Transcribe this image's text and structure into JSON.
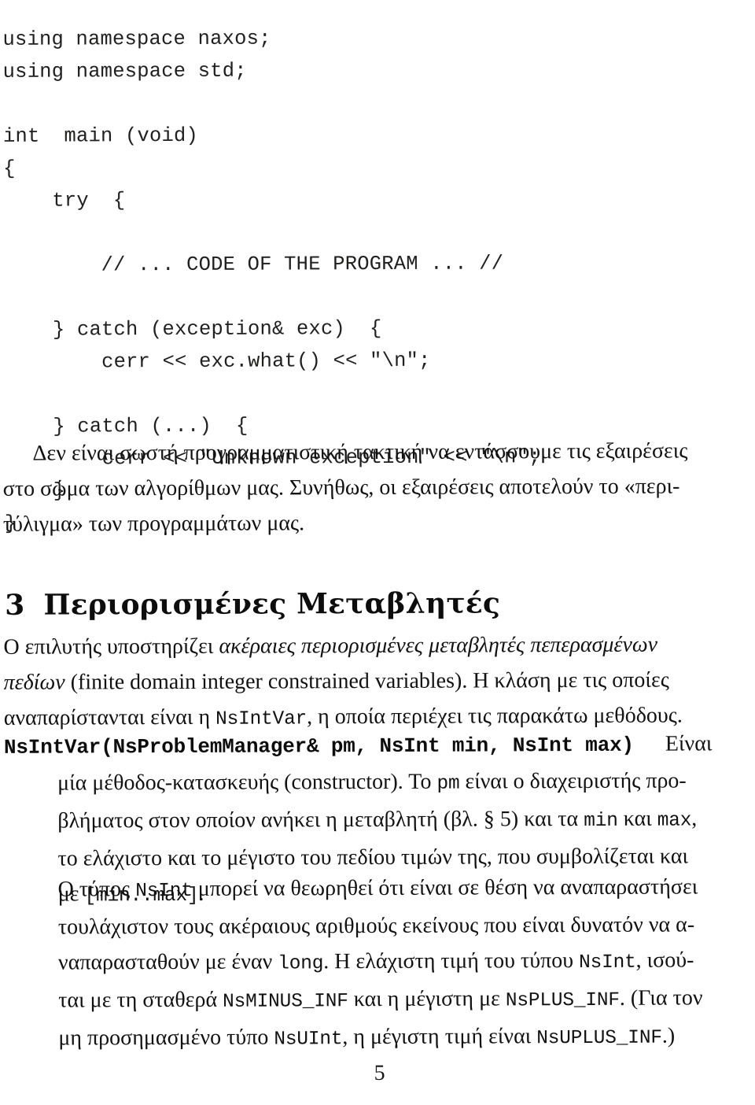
{
  "code_listing": {
    "name": "cpp-exception-skeleton",
    "lines": [
      "using namespace naxos;",
      "using namespace std;",
      "",
      "int  main (void)",
      "{",
      "    try  {",
      "",
      "        // ... CODE OF THE PROGRAM ... //",
      "",
      "    } catch (exception& exc)  {",
      "        cerr << exc.what() << \"\\n\";",
      "",
      "    } catch (...)  {",
      "        cerr << \"Unknown exception\" << \"\\n\";",
      "    }",
      "}"
    ]
  },
  "intro_paragraph": {
    "lines": [
      "Δεν είναι σωστή προγραμματιστική τακτική να εντάσσουμε τις εξαιρέσεις",
      "στο σώμα των αλγορίθμων μας. Συνήθως, οι εξαιρέσεις αποτελούν το «περι-",
      "τύλιγμα» των προγραμμάτων μας."
    ]
  },
  "section": {
    "number": "3",
    "title": "Περιορισμένες Μεταβλητές"
  },
  "solver_paragraph": {
    "line1_prefix": "Ο επιλυτής υποστηρίζει ",
    "line1_italic": "ακέραιες περιορισμένες μεταβλητές πεπερασμένων",
    "line2_italic": "πεδίων",
    "line2_rest": " (finite domain integer constrained variables). Η κλάση με τις οποίες",
    "line3_prefix": "αναπαρίστανται είναι η ",
    "line3_mono": "NsIntVar",
    "line3_suffix": ", η οποία περιέχει τις παρακάτω μεθόδους."
  },
  "constructor_entry": {
    "signature": "NsIntVar(NsProblemManager& pm, NsInt min, NsInt max)",
    "signature_tail": "Είναι",
    "desc_line1_a": "μία μέθοδος-κατασκευής (constructor). Το ",
    "desc_line1_mono": "pm",
    "desc_line1_b": " είναι ο διαχειριστής προ-",
    "desc_line2_a": "βλήματος στον οποίον ανήκει η μεταβλητή (βλ. § 5) και τα ",
    "desc_line2_mono1": "min",
    "desc_line2_b": " και ",
    "desc_line2_mono2": "max",
    "desc_line2_c": ",",
    "desc_line3": "το ελάχιστο και το μέγιστο του πεδίου τιμών της, που συμβολίζεται και",
    "desc_line4_a": "με ",
    "desc_line4_mono": "[min..max]",
    "desc_line4_b": "."
  },
  "nsint_paragraph": {
    "line1_a": "Ο τύπος ",
    "line1_mono": "NsInt",
    "line1_b": " μπορεί να θεωρηθεί ότι είναι σε θέση να αναπαραστήσει",
    "line2": "τουλάχιστον τους ακέραιους αριθμούς εκείνους που είναι δυνατόν να α-",
    "line3_a": "ναπαρασταθούν με έναν ",
    "line3_mono1": "long",
    "line3_b": ". Η ελάχιστη τιμή του τύπου ",
    "line3_mono2": "NsInt",
    "line3_c": ", ισού-",
    "line4_a": "ται με τη σταθερά ",
    "line4_mono1": "NsMINUS_INF",
    "line4_b": " και η μέγιστη με ",
    "line4_mono2": "NsPLUS_INF",
    "line4_c": ". (Για τον",
    "line5_a": "μη προσημασμένο τύπο ",
    "line5_mono1": "NsUInt",
    "line5_b": ", η μέγιστη τιμή είναι ",
    "line5_mono2": "NsUPLUS_INF",
    "line5_c": ".)"
  },
  "footer": {
    "page_number": "5"
  },
  "colors": {
    "page_background": "#ffffff",
    "body_text": "#121212",
    "code_text": "#20201f"
  }
}
